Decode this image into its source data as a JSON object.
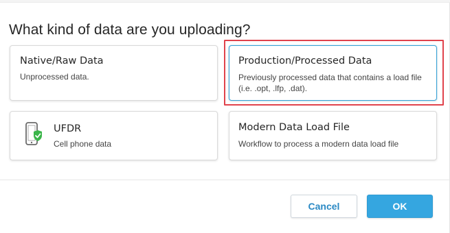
{
  "dialog": {
    "title": "What kind of data are you uploading?",
    "options": [
      {
        "title": "Native/Raw Data",
        "description": "Unprocessed data."
      },
      {
        "title": "Production/Processed Data",
        "description": "Previously processed data that contains a load file (i.e. .opt, .lfp, .dat).",
        "selected": true
      },
      {
        "title": "UFDR",
        "description": "Cell phone data",
        "icon": "phone-check-icon"
      },
      {
        "title": "Modern Data Load File",
        "description": "Workflow to process a modern data load file"
      }
    ],
    "buttons": {
      "cancel": "Cancel",
      "ok": "OK"
    }
  },
  "colors": {
    "accent": "#35a6e0",
    "selected_border": "#3aa3d6",
    "highlight_outline": "#e0424b",
    "check_badge": "#3bb54a"
  }
}
